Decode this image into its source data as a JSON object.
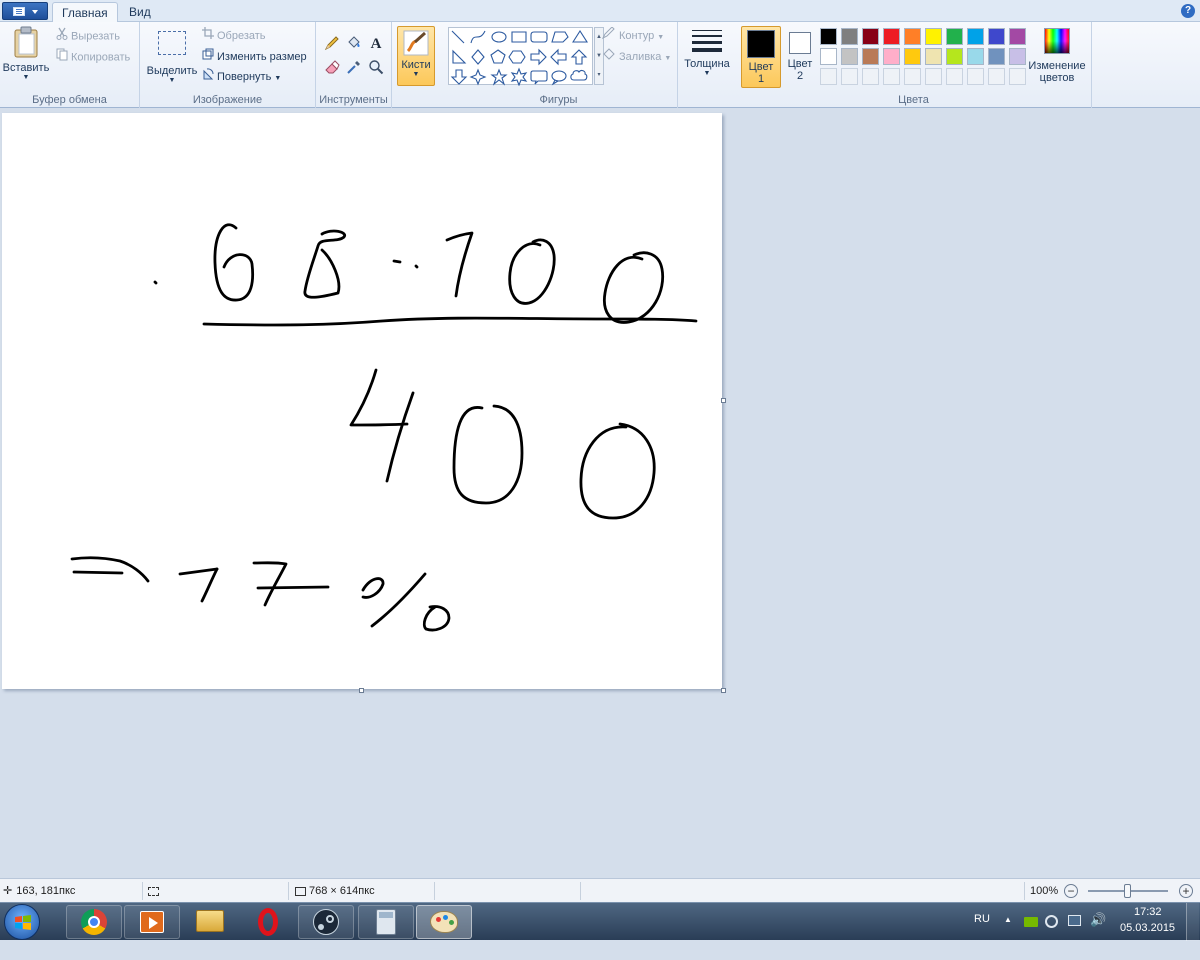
{
  "tabs": [
    {
      "label": "Главная"
    },
    {
      "label": "Вид"
    }
  ],
  "help_label": "?",
  "clipboard": {
    "paste_label": "Вставить",
    "cut_label": "Вырезать",
    "copy_label": "Копировать",
    "group_label": "Буфер обмена"
  },
  "image": {
    "select_label": "Выделить",
    "crop_label": "Обрезать",
    "resize_label": "Изменить размер",
    "rotate_label": "Повернуть",
    "group_label": "Изображение"
  },
  "tools": {
    "group_label": "Инструменты",
    "text_tool_glyph": "A"
  },
  "brushes": {
    "label": "Кисти"
  },
  "shapes": {
    "outline_label": "Контур",
    "fill_label": "Заливка",
    "group_label": "Фигуры"
  },
  "size": {
    "label": "Толщина"
  },
  "color1": {
    "label_line1": "Цвет",
    "label_line2": "1",
    "value": "#000000"
  },
  "color2": {
    "label_line1": "Цвет",
    "label_line2": "2",
    "value": "#ffffff"
  },
  "colors": {
    "group_label": "Цвета",
    "edit_label_line1": "Изменение",
    "edit_label_line2": "цветов",
    "row1": [
      "#000000",
      "#7f7f7f",
      "#880015",
      "#ed1c24",
      "#ff7f27",
      "#fff200",
      "#22b14c",
      "#00a2e8",
      "#3f48cc",
      "#a349a4"
    ],
    "row2": [
      "#ffffff",
      "#c3c3c3",
      "#b97a57",
      "#ffaec9",
      "#ffc90e",
      "#efe4b0",
      "#b5e61d",
      "#99d9ea",
      "#7092be",
      "#c8bfe7"
    ]
  },
  "drawing": {
    "strokes": [
      "M153,169 L154,170",
      "M234,115 C222,104 212,122 213,150 C214,178 222,188 235,187 C250,186 252,168 250,151 C248,138 228,138 222,154",
      "M320,121 C330,115 346,119 342,124 C335,130 318,124 316,133 C312,146 305,164 303,178 C301,188 320,184 336,180 C340,168 330,146 320,137",
      "M392,148 L398,149",
      "M414,153 L415,154",
      "M445,127 C454,123 462,121 470,120 C463,140 457,160 454,183",
      "M538,132 C524,126 510,140 508,160 C506,180 514,193 527,190 C543,186 554,160 552,142 C550,128 540,124 531,129",
      "M640,146 C620,138 606,160 603,180 C600,198 608,212 627,209 C650,205 664,178 660,156 C657,140 643,137 632,142",
      "M202,211 C280,213 330,212 380,208 C450,203 520,206 600,206 C640,206 670,206 694,208",
      "M374,257 C368,278 358,298 349,312 C362,312 388,312 405,311",
      "M411,280 C402,305 393,333 385,368",
      "M480,295 C458,290 452,320 452,355 C452,380 462,390 484,390 C508,390 520,368 520,340 C520,310 510,294 492,293",
      "M624,314 C596,312 580,338 579,366 C578,392 588,405 611,405 C636,405 650,385 652,360 C654,335 642,314 618,311",
      "M70,446 C85,444 100,444 118,448 C130,452 140,460 146,468",
      "M72,459 L120,460",
      "M178,461 L215,456",
      "M215,456 C210,466 205,478 200,488",
      "M252,450 C262,450 273,449 284,451 C278,463 270,476 263,492",
      "M256,475 L326,474",
      "M361,477 C369,463 382,463 381,471 C378,480 368,486 361,484",
      "M423,461 C405,482 387,500 370,513",
      "M428,494 C439,492 447,497 447,505 C446,515 433,519 424,516 C420,512 423,500 433,494"
    ]
  },
  "status": {
    "cursor_pos": "163, 181пкс",
    "image_size": "768 × 614пкс",
    "zoom": "100%"
  },
  "tray": {
    "lang": "RU",
    "time": "17:32",
    "date": "05.03.2015"
  }
}
